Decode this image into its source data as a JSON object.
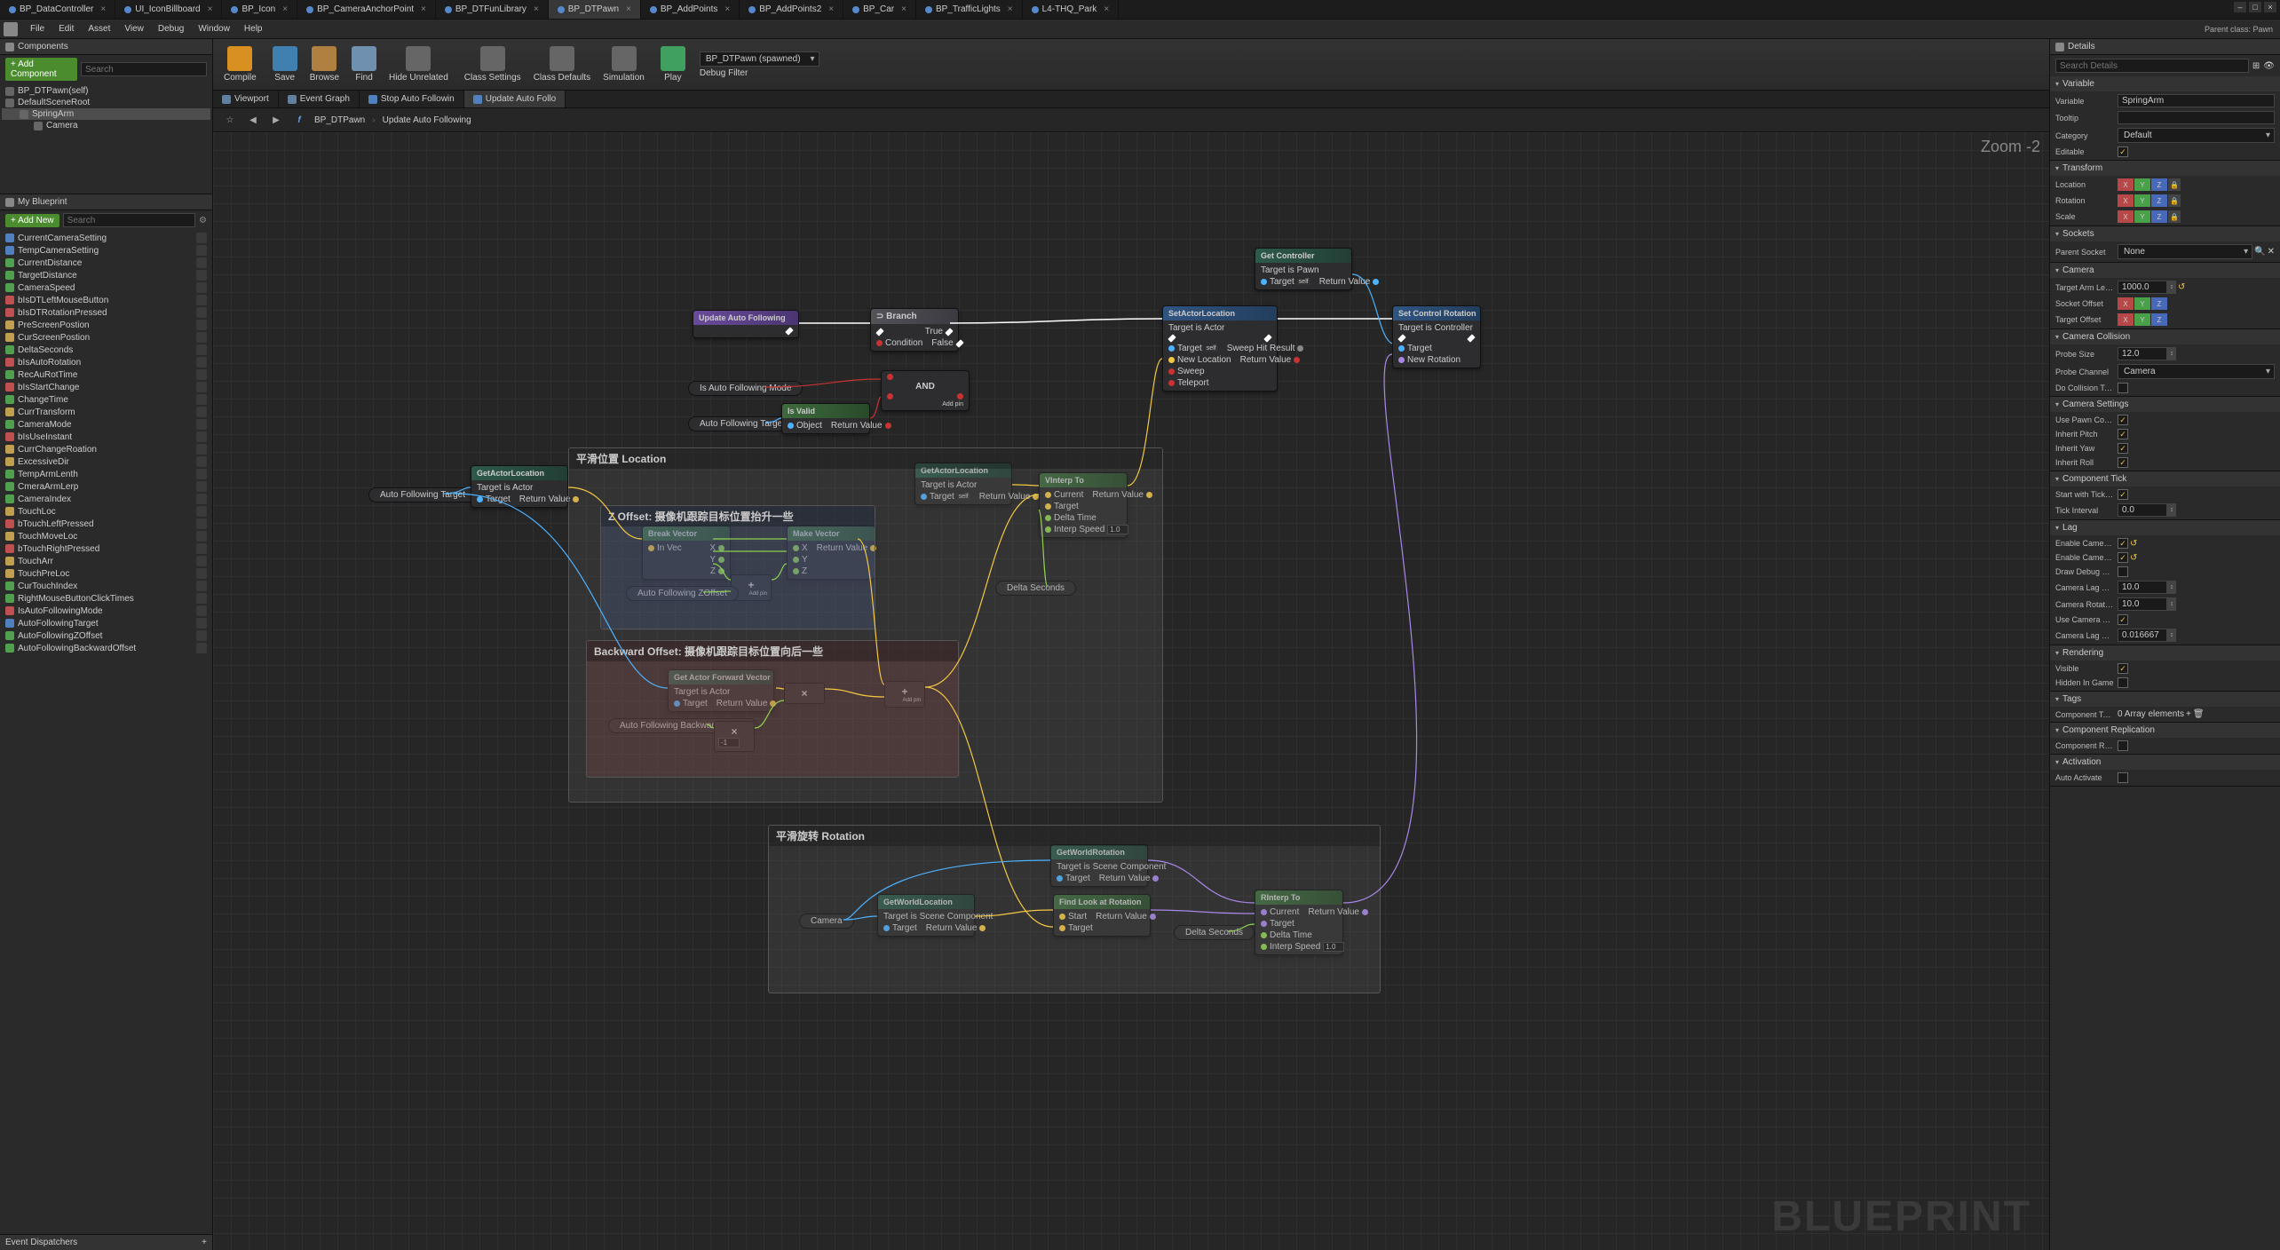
{
  "menu": {
    "file": "File",
    "edit": "Edit",
    "asset": "Asset",
    "view": "View",
    "debug": "Debug",
    "window": "Window",
    "help": "Help"
  },
  "parentClass": "Parent class: Pawn",
  "tabs": [
    {
      "label": "BP_DataController"
    },
    {
      "label": "UI_IconBillboard"
    },
    {
      "label": "BP_Icon"
    },
    {
      "label": "BP_CameraAnchorPoint"
    },
    {
      "label": "BP_DTFunLibrary"
    },
    {
      "label": "BP_DTPawn",
      "active": true
    },
    {
      "label": "BP_AddPoints"
    },
    {
      "label": "BP_AddPoints2"
    },
    {
      "label": "BP_Car"
    },
    {
      "label": "BP_TrafficLights"
    },
    {
      "label": "L4-THQ_Park"
    }
  ],
  "toolbar": {
    "compile": "Compile",
    "save": "Save",
    "browse": "Browse",
    "find": "Find",
    "hide": "Hide Unrelated",
    "classSettings": "Class Settings",
    "classDefaults": "Class Defaults",
    "simulation": "Simulation",
    "play": "Play",
    "debugCombo": "BP_DTPawn (spawned)",
    "debugFilter": "Debug Filter"
  },
  "components": {
    "title": "Components",
    "addComponent": "+ Add Component",
    "search": "Search",
    "items": [
      {
        "label": "BP_DTPawn(self)",
        "cls": ""
      },
      {
        "label": "DefaultSceneRoot",
        "cls": ""
      },
      {
        "label": "SpringArm",
        "cls": "selected",
        "indent": 16
      },
      {
        "label": "Camera",
        "cls": "",
        "indent": 32
      }
    ]
  },
  "myBlueprint": {
    "title": "My Blueprint",
    "addNew": "+ Add New",
    "search": "Search",
    "vars": [
      {
        "label": "CurrentCameraSetting",
        "c": "blue"
      },
      {
        "label": "TempCameraSetting",
        "c": "blue"
      },
      {
        "label": "CurrentDistance",
        "c": "green"
      },
      {
        "label": "TargetDistance",
        "c": "green"
      },
      {
        "label": "CameraSpeed",
        "c": "green"
      },
      {
        "label": "bIsDTLeftMouseButton",
        "c": "red"
      },
      {
        "label": "bIsDTRotationPressed",
        "c": "red"
      },
      {
        "label": "PreScreenPostion",
        "c": "yellow"
      },
      {
        "label": "CurScreenPostion",
        "c": "yellow"
      },
      {
        "label": "DeltaSeconds",
        "c": "green"
      },
      {
        "label": "bIsAutoRotation",
        "c": "red"
      },
      {
        "label": "RecAuRotTime",
        "c": "green"
      },
      {
        "label": "bIsStartChange",
        "c": "red"
      },
      {
        "label": "ChangeTime",
        "c": "green"
      },
      {
        "label": "CurrTransform",
        "c": "yellow"
      },
      {
        "label": "CameraMode",
        "c": "green"
      },
      {
        "label": "bIsUseInstant",
        "c": "red"
      },
      {
        "label": "CurrChangeRoation",
        "c": "yellow"
      },
      {
        "label": "ExcessiveDir",
        "c": "yellow"
      },
      {
        "label": "TempArmLenth",
        "c": "green"
      },
      {
        "label": "CmeraArmLerp",
        "c": "green"
      },
      {
        "label": "CameraIndex",
        "c": "green"
      },
      {
        "label": "TouchLoc",
        "c": "yellow"
      },
      {
        "label": "bTouchLeftPressed",
        "c": "red"
      },
      {
        "label": "TouchMoveLoc",
        "c": "yellow"
      },
      {
        "label": "bTouchRightPressed",
        "c": "red"
      },
      {
        "label": "TouchArr",
        "c": "yellow"
      },
      {
        "label": "TouchPreLoc",
        "c": "yellow"
      },
      {
        "label": "CurTouchIndex",
        "c": "green"
      },
      {
        "label": "RightMouseButtonClickTimes",
        "c": "green"
      },
      {
        "label": "IsAutoFollowingMode",
        "c": "red"
      },
      {
        "label": "AutoFollowingTarget",
        "c": "blue"
      },
      {
        "label": "AutoFollowingZOffset",
        "c": "green"
      },
      {
        "label": "AutoFollowingBackwardOffset",
        "c": "green"
      }
    ],
    "eventDispatchers": "Event Dispatchers"
  },
  "graphTabs": [
    {
      "label": "Viewport",
      "icon": "gi"
    },
    {
      "label": "Event Graph",
      "icon": "gi"
    },
    {
      "label": "Stop Auto Followin",
      "icon": "fn"
    },
    {
      "label": "Update Auto Follo",
      "icon": "fn",
      "active": true
    }
  ],
  "breadcrumb": {
    "bp": "BP_DTPawn",
    "fn": "Update Auto Following"
  },
  "zoom": "Zoom -2",
  "watermark": "BLUEPRINT",
  "comments": {
    "location": "平滑位置 Location",
    "zoffset": "Z Offset: 摄像机跟踪目标位置抬升一些",
    "backward": "Backward Offset: 摄像机跟踪目标位置向后一些",
    "rotation": "平滑旋转 Rotation"
  },
  "nodes": {
    "updateAuto": "Update Auto Following",
    "isAutoMode": "Is Auto Following Mode",
    "autoTarget": "Auto Following Target",
    "branch": "Branch",
    "true": "True",
    "false": "False",
    "condition": "Condition",
    "and": "AND",
    "addPin": "Add pin",
    "isValid": "Is Valid",
    "object": "Object",
    "returnValue": "Return Value",
    "getController": "Get Controller",
    "setActorLoc": "SetActorLocation",
    "setControlRot": "Set Control Rotation",
    "target": "Target",
    "self": "self",
    "newLocation": "New Location",
    "sweep": "Sweep",
    "teleport": "Teleport",
    "sweepHit": "Sweep Hit Result",
    "newRotation": "New Rotation",
    "getActorLoc": "GetActorLocation",
    "getActorLoc2": "GetActorLocation",
    "vinterp": "VInterp To",
    "current": "Current",
    "targetPin": "Target",
    "deltaTime": "Delta Time",
    "interpSpeed": "Interp Speed",
    "interpVal": "1.0",
    "breakVector": "Break Vector",
    "inVec": "In Vec",
    "x": "X",
    "y": "Y",
    "z": "Z",
    "makeVector": "Make Vector",
    "autoZOffset": "Auto Following ZOffset",
    "deltaSeconds": "Delta Seconds",
    "getActorForward": "Get Actor Forward Vector",
    "autoBackward": "Auto Following Backward Offset",
    "getWorldRot": "GetWorldRotation",
    "getWorldLoc": "GetWorldLocation",
    "camera": "Camera",
    "findLookAt": "Find Look at Rotation",
    "start": "Start",
    "rinterp": "RInterp To",
    "targetIsActor": "Target is Actor",
    "targetIsPawn": "Target is Pawn",
    "targetIsController": "Target is Controller",
    "targetIsScene": "Target is Scene Component"
  },
  "details": {
    "title": "Details",
    "searchDetails": "Search Details",
    "variable": {
      "section": "Variable",
      "name": "Variable",
      "val": "SpringArm",
      "tooltip": "Tooltip",
      "category": "Category",
      "categoryVal": "Default",
      "editable": "Editable"
    },
    "transform": {
      "section": "Transform",
      "location": "Location",
      "rotation": "Rotation",
      "scale": "Scale"
    },
    "sockets": {
      "section": "Sockets",
      "parent": "Parent Socket",
      "none": "None"
    },
    "camera": {
      "section": "Camera",
      "targetArm": "Target Arm Length",
      "targetArmVal": "1000.0",
      "socketOff": "Socket Offset",
      "targetOff": "Target Offset"
    },
    "collision": {
      "section": "Camera Collision",
      "probeSize": "Probe Size",
      "probeSizeVal": "12.0",
      "probeCh": "Probe Channel",
      "probeChVal": "Camera",
      "doColl": "Do Collision Test"
    },
    "settings": {
      "section": "Camera Settings",
      "usePawn": "Use Pawn Control Rotation",
      "inheritP": "Inherit Pitch",
      "inheritY": "Inherit Yaw",
      "inheritR": "Inherit Roll"
    },
    "tick": {
      "section": "Component Tick",
      "startWith": "Start with Tick Enabled",
      "tickInt": "Tick Interval",
      "tickIntVal": "0.0"
    },
    "lag": {
      "section": "Lag",
      "enableCL": "Enable Camera Lag",
      "enableCR": "Enable Camera Rotation Lag",
      "drawDebug": "Draw Debug Lag Markers",
      "camLagS": "Camera Lag Speed",
      "camLagSVal": "10.0",
      "camRotS": "Camera Rotation Lag Speed",
      "camRotSVal": "10.0",
      "useCamLag": "Use Camera Lag Substepping",
      "camLagMax": "Camera Lag Max Time Step",
      "camLagMaxVal": "0.016667"
    },
    "rendering": {
      "section": "Rendering",
      "visible": "Visible",
      "hidden": "Hidden In Game"
    },
    "tags": {
      "section": "Tags",
      "compTags": "Component Tags",
      "arr": "0 Array elements"
    },
    "replication": {
      "section": "Component Replication",
      "compRep": "Component Replicates"
    },
    "activation": {
      "section": "Activation",
      "autoAct": "Auto Activate"
    }
  }
}
